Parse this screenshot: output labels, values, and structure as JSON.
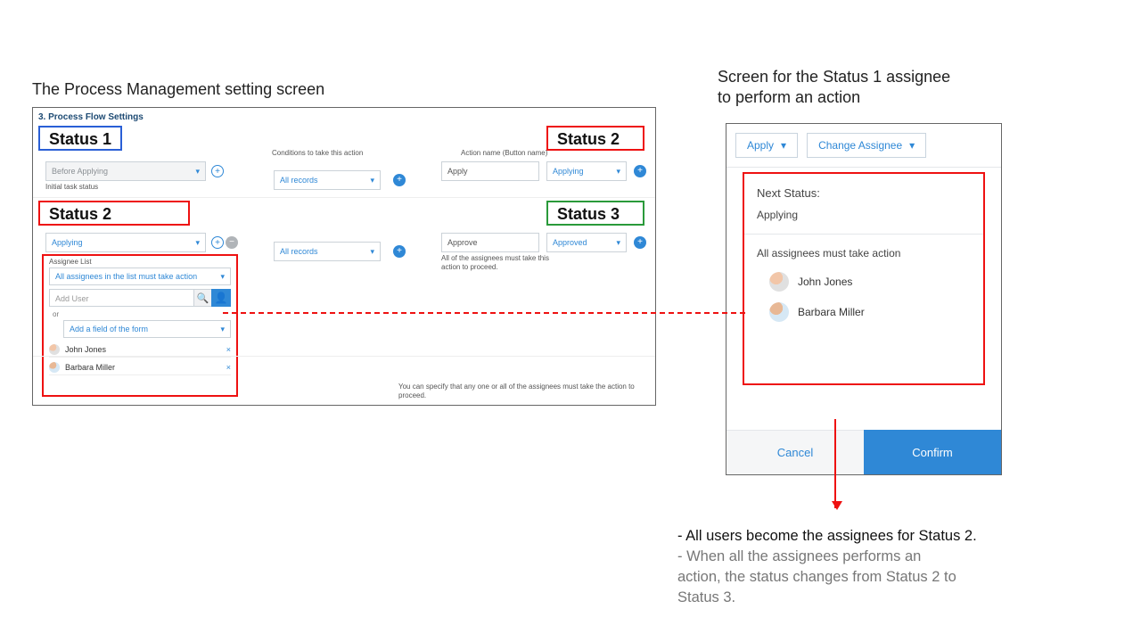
{
  "captions": {
    "left": "The Process Management setting screen",
    "right": "Screen for the Status 1 assignee\n to perform an action"
  },
  "tags": {
    "status1": "Status 1",
    "status2a": "Status 2",
    "status2b": "Status 2",
    "status3": "Status 3"
  },
  "settings": {
    "header": "3. Process Flow Settings",
    "col_conditions": "Conditions to take this action",
    "col_action_name": "Action name (Button name)",
    "row1": {
      "status_field": "Before Applying",
      "initial_label": "Initial task status",
      "condition": "All records",
      "action_input": "Apply",
      "next_status": "Applying"
    },
    "row2": {
      "status_field": "Applying",
      "condition": "All records",
      "action_input": "Approve",
      "next_status": "Approved",
      "action_note": "All of the assignees must take this action to proceed."
    },
    "assignee": {
      "label": "Assignee List",
      "rule": "All assignees in the list must take action",
      "add_user_placeholder": "Add User",
      "or": "or",
      "add_field": "Add a field of the form",
      "users": [
        "John Jones",
        "Barbara Miller"
      ]
    },
    "footer_hint": "You can specify that any one or all of the assignees must take the action to proceed."
  },
  "action": {
    "apply_btn": "Apply",
    "change_assignee_btn": "Change Assignee",
    "next_status_label": "Next Status:",
    "next_status_value": "Applying",
    "rule": "All assignees must take action",
    "users": [
      "John Jones",
      "Barbara Miller"
    ],
    "cancel": "Cancel",
    "confirm": "Confirm"
  },
  "notes": {
    "line1": "- All users become the assignees for Status 2.",
    "line2": "- When all the assignees performs an",
    "line3": "  action, the status changes from Status 2 to",
    "line4": "  Status 3."
  },
  "icons": {
    "caret": "▾",
    "search": "🔍",
    "person": "👤",
    "remove": "×",
    "plus": "+"
  }
}
